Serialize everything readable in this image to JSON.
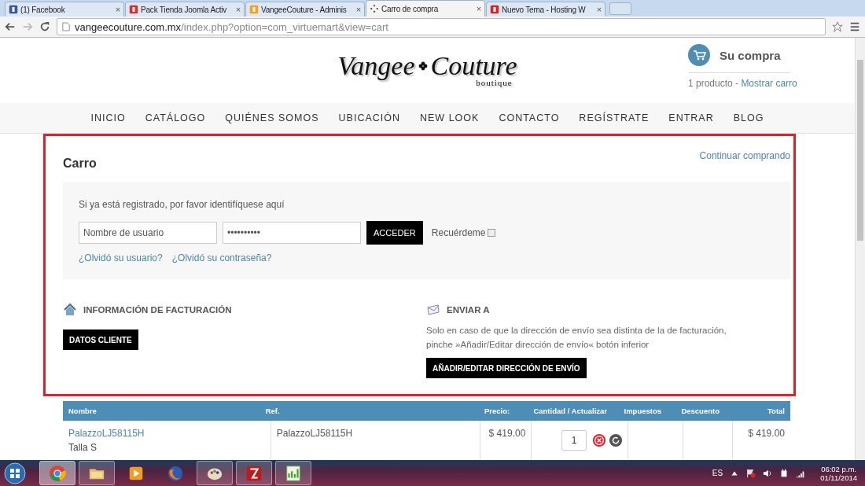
{
  "browser": {
    "tabs": [
      {
        "label": "(1) Facebook",
        "kind": "facebook",
        "selected": false
      },
      {
        "label": "Pack Tienda Joomla Activ",
        "kind": "gmail",
        "selected": false
      },
      {
        "label": "VangeeCouture - Adminis",
        "kind": "joomla",
        "selected": false
      },
      {
        "label": "Carro de compra",
        "kind": "loading",
        "selected": true
      },
      {
        "label": "Nuevo Tema - Hosting W",
        "kind": "hosting",
        "selected": false
      }
    ],
    "close": "×",
    "url_host": "vangeecouture.com.mx",
    "url_path": "/index.php?option=com_virtuemart&view=cart"
  },
  "header": {
    "logo": {
      "left": "Vangee",
      "right": "Couture",
      "tagline": "boutique"
    },
    "cart": {
      "title": "Su compra",
      "count": "1 producto - ",
      "link": "Mostrar carro"
    }
  },
  "nav": [
    "INICIO",
    "CATÁLOGO",
    "QUIÉNES SOMOS",
    "UBICACIÓN",
    "NEW LOOK",
    "CONTACTO",
    "REGÍSTRATE",
    "ENTRAR",
    "BLOG"
  ],
  "cart": {
    "title": "Carro",
    "continue": "Continuar comprando",
    "login": {
      "prompt": "Si ya está registrado, por favor identifíquese aquí",
      "username_placeholder": "Nombre de usuario",
      "password": "••••••••••",
      "submit": "ACCEDER",
      "remember": "Recuérdeme",
      "remember_checked": false,
      "forgot_user": "¿Olvidó su usuario?",
      "forgot_password": "¿Olvidó su contraseña?"
    },
    "billing": {
      "title": "INFORMACIÓN DE FACTURACIÓN",
      "button": "DATOS CLIENTE"
    },
    "shipping": {
      "title": "ENVIAR A",
      "note": "Solo en caso de que la dirección de envío sea distinta de la de facturación, pinche »Añadir/Editar dirección de envío« botón inferior",
      "button": "AÑADIR/EDITAR DIRECCIÓN DE ENVÍO"
    }
  },
  "table": {
    "columns": [
      "Nombre",
      "Ref.",
      "Precio:",
      "Cantidad / Actualizar",
      "Impuestos",
      "Descuento",
      "Total"
    ],
    "rows": [
      {
        "name": "PalazzoLJ58115H",
        "variant": "Talla S",
        "ref": "PalazzoLJ58115H",
        "price": "$ 419.00",
        "quantity": "1",
        "total": "$ 419.00"
      }
    ]
  },
  "taskbar": {
    "apps": [
      {
        "kind": "chrome",
        "running": true,
        "selected": true
      },
      {
        "kind": "folder",
        "running": true,
        "selected": false
      },
      {
        "kind": "media",
        "running": false,
        "selected": false
      },
      {
        "kind": "firefox",
        "running": false,
        "selected": false
      },
      {
        "kind": "paint",
        "running": true,
        "selected": false
      },
      {
        "kind": "filezilla",
        "running": true,
        "selected": false
      },
      {
        "kind": "chart",
        "running": true,
        "selected": false
      }
    ],
    "language": "ES",
    "time": "06:02 p.m.",
    "date": "01/11/2014"
  }
}
